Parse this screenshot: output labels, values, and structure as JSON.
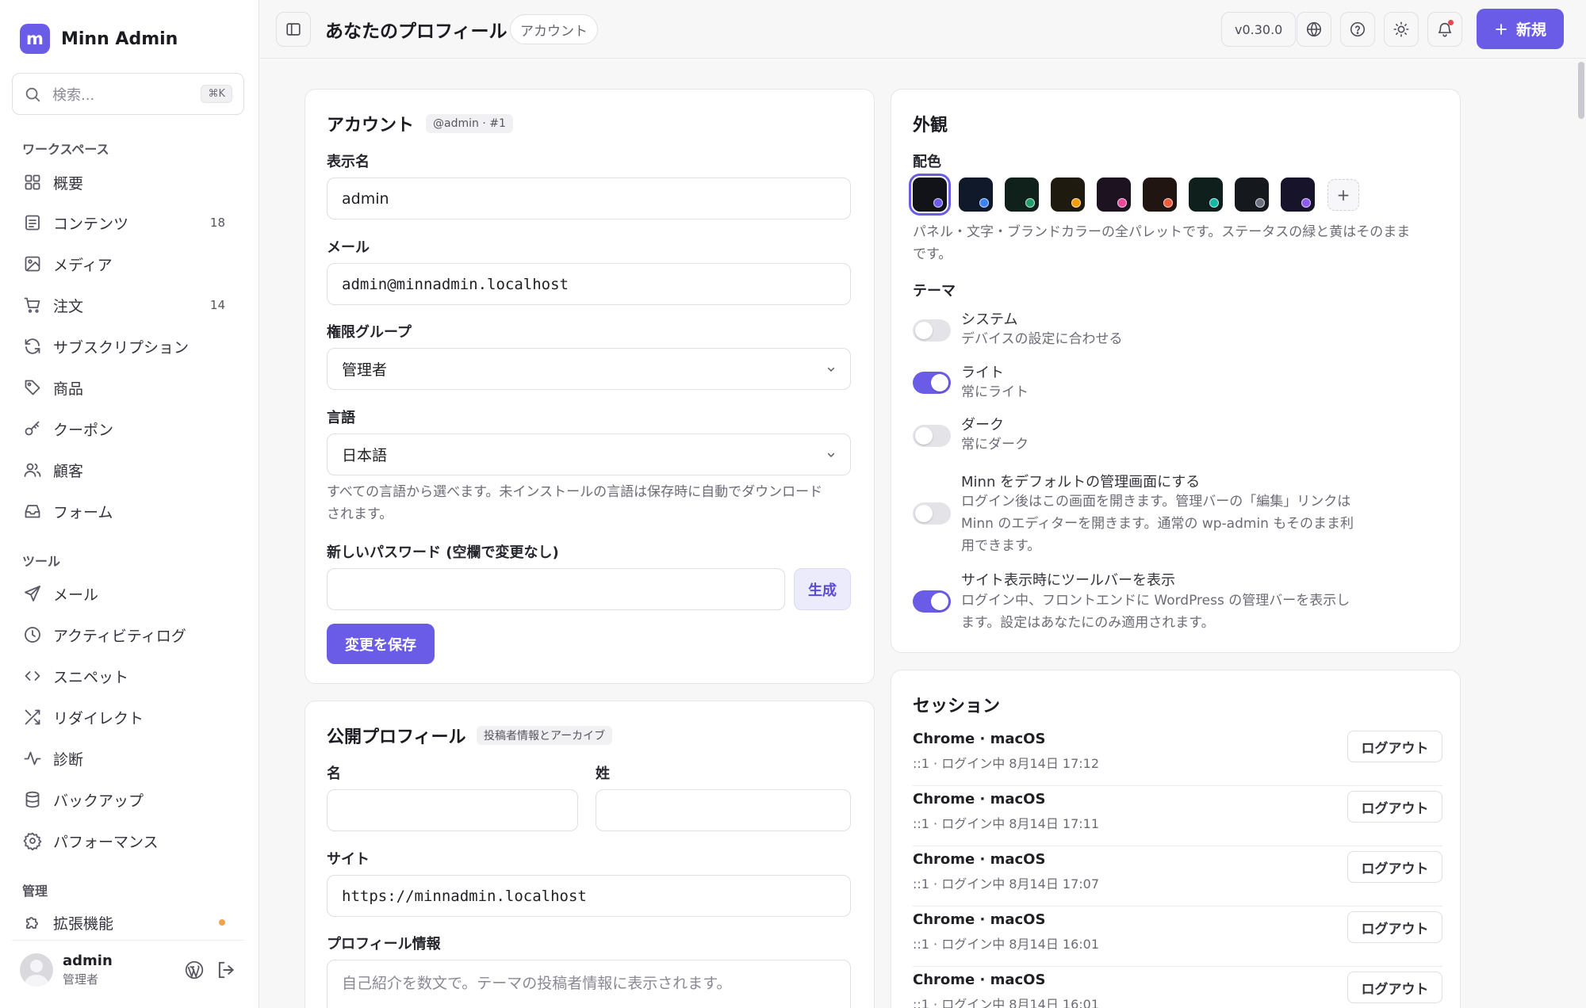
{
  "app": {
    "logo_letter": "m",
    "name": "Minn Admin"
  },
  "search": {
    "placeholder": "検索...",
    "shortcut": "⌘K"
  },
  "sidebar": {
    "workspace_label": "ワークスペース",
    "workspace_items": [
      {
        "label": "概要",
        "icon": "grid-icon",
        "count": ""
      },
      {
        "label": "コンテンツ",
        "icon": "document-icon",
        "count": "18"
      },
      {
        "label": "メディア",
        "icon": "image-icon",
        "count": ""
      },
      {
        "label": "注文",
        "icon": "cart-icon",
        "count": "14"
      },
      {
        "label": "サブスクリプション",
        "icon": "refresh-icon",
        "count": ""
      },
      {
        "label": "商品",
        "icon": "tag-icon",
        "count": ""
      },
      {
        "label": "クーポン",
        "icon": "key-icon",
        "count": ""
      },
      {
        "label": "顧客",
        "icon": "users-icon",
        "count": ""
      },
      {
        "label": "フォーム",
        "icon": "inbox-icon",
        "count": ""
      }
    ],
    "tools_label": "ツール",
    "tools_items": [
      {
        "label": "メール",
        "icon": "send-icon"
      },
      {
        "label": "アクティビティログ",
        "icon": "clock-icon"
      },
      {
        "label": "スニペット",
        "icon": "code-icon"
      },
      {
        "label": "リダイレクト",
        "icon": "shuffle-icon"
      },
      {
        "label": "診断",
        "icon": "activity-icon"
      },
      {
        "label": "バックアップ",
        "icon": "database-icon"
      },
      {
        "label": "パフォーマンス",
        "icon": "gear-icon"
      }
    ],
    "admin_label": "管理",
    "admin_items": [
      {
        "label": "拡張機能",
        "icon": "puzzle-icon",
        "has_dot": true
      }
    ]
  },
  "user": {
    "name": "admin",
    "role": "管理者"
  },
  "topbar": {
    "title": "あなたのプロフィール",
    "chip": "アカウント",
    "version": "v0.30.0",
    "new_label": "新規"
  },
  "account": {
    "title": "アカウント",
    "tag": "@admin · #1",
    "display_name_label": "表示名",
    "display_name_value": "admin",
    "email_label": "メール",
    "email_value": "admin@minnadmin.localhost",
    "role_label": "権限グループ",
    "role_value": "管理者",
    "language_label": "言語",
    "language_value": "日本語",
    "language_help_1": "すべての言語から選べます。未インストールの言語は保存時に自動でダウンロード",
    "language_help_2": "されます。",
    "password_label": "新しいパスワード (空欄で変更なし)",
    "password_value": "",
    "generate_label": "生成",
    "save_label": "変更を保存"
  },
  "public_profile": {
    "title": "公開プロフィール",
    "tag": "投稿者情報とアーカイブ",
    "first_name_label": "名",
    "last_name_label": "姓",
    "site_label": "サイト",
    "site_value": "https://minnadmin.localhost",
    "bio_label": "プロフィール情報",
    "bio_placeholder": "自己紹介を数文で。テーマの投稿者情報に表示されます。"
  },
  "appearance": {
    "title": "外観",
    "palette_label": "配色",
    "swatches": [
      {
        "bg": "#111318",
        "dot": "#6b5ce7",
        "selected": true
      },
      {
        "bg": "#10192a",
        "dot": "#3b82f6",
        "selected": false
      },
      {
        "bg": "#10201a",
        "dot": "#22a06b",
        "selected": false
      },
      {
        "bg": "#1f1a10",
        "dot": "#f59e0b",
        "selected": false
      },
      {
        "bg": "#1d1320",
        "dot": "#ec4899",
        "selected": false
      },
      {
        "bg": "#211511",
        "dot": "#ef5b3a",
        "selected": false
      },
      {
        "bg": "#0f1f1c",
        "dot": "#14b8a6",
        "selected": false
      },
      {
        "bg": "#15181d",
        "dot": "#6b7280",
        "selected": false
      },
      {
        "bg": "#16132a",
        "dot": "#8b5cf6",
        "selected": false
      }
    ],
    "palette_help_1": "パネル・文字・ブランドカラーの全パレットです。ステータスの緑と黄はそのまま",
    "palette_help_2": "です。",
    "theme_label": "テーマ",
    "options": [
      {
        "title": "システム",
        "desc": [
          "デバイスの設定に合わせる"
        ],
        "on": false
      },
      {
        "title": "ライト",
        "desc": [
          "常にライト"
        ],
        "on": true
      },
      {
        "title": "ダーク",
        "desc": [
          "常にダーク"
        ],
        "on": false
      },
      {
        "title": "Minn をデフォルトの管理画面にする",
        "desc": [
          "ログイン後はこの画面を開きます。管理バーの「編集」リンクは",
          "Minn のエディターを開きます。通常の wp-admin もそのまま利",
          "用できます。"
        ],
        "on": false
      },
      {
        "title": "サイト表示時にツールバーを表示",
        "desc": [
          "ログイン中、フロントエンドに WordPress の管理バーを表示し",
          "ます。設定はあなたにのみ適用されます。"
        ],
        "on": true
      }
    ]
  },
  "sessions": {
    "title": "セッション",
    "logout_label": "ログアウト",
    "items": [
      {
        "device": "Chrome · macOS",
        "meta": "::1 · ログイン中 8月14日 17:12"
      },
      {
        "device": "Chrome · macOS",
        "meta": "::1 · ログイン中 8月14日 17:11"
      },
      {
        "device": "Chrome · macOS",
        "meta": "::1 · ログイン中 8月14日 17:07"
      },
      {
        "device": "Chrome · macOS",
        "meta": "::1 · ログイン中 8月14日 16:01"
      },
      {
        "device": "Chrome · macOS",
        "meta": "::1 · ログイン中 8月14日 16:01"
      }
    ]
  },
  "colors": {
    "accent": "#6b5ce7",
    "accent_soft": "#ecebfb",
    "notification": "#e5484d",
    "warning_dot": "#f0a34a"
  }
}
